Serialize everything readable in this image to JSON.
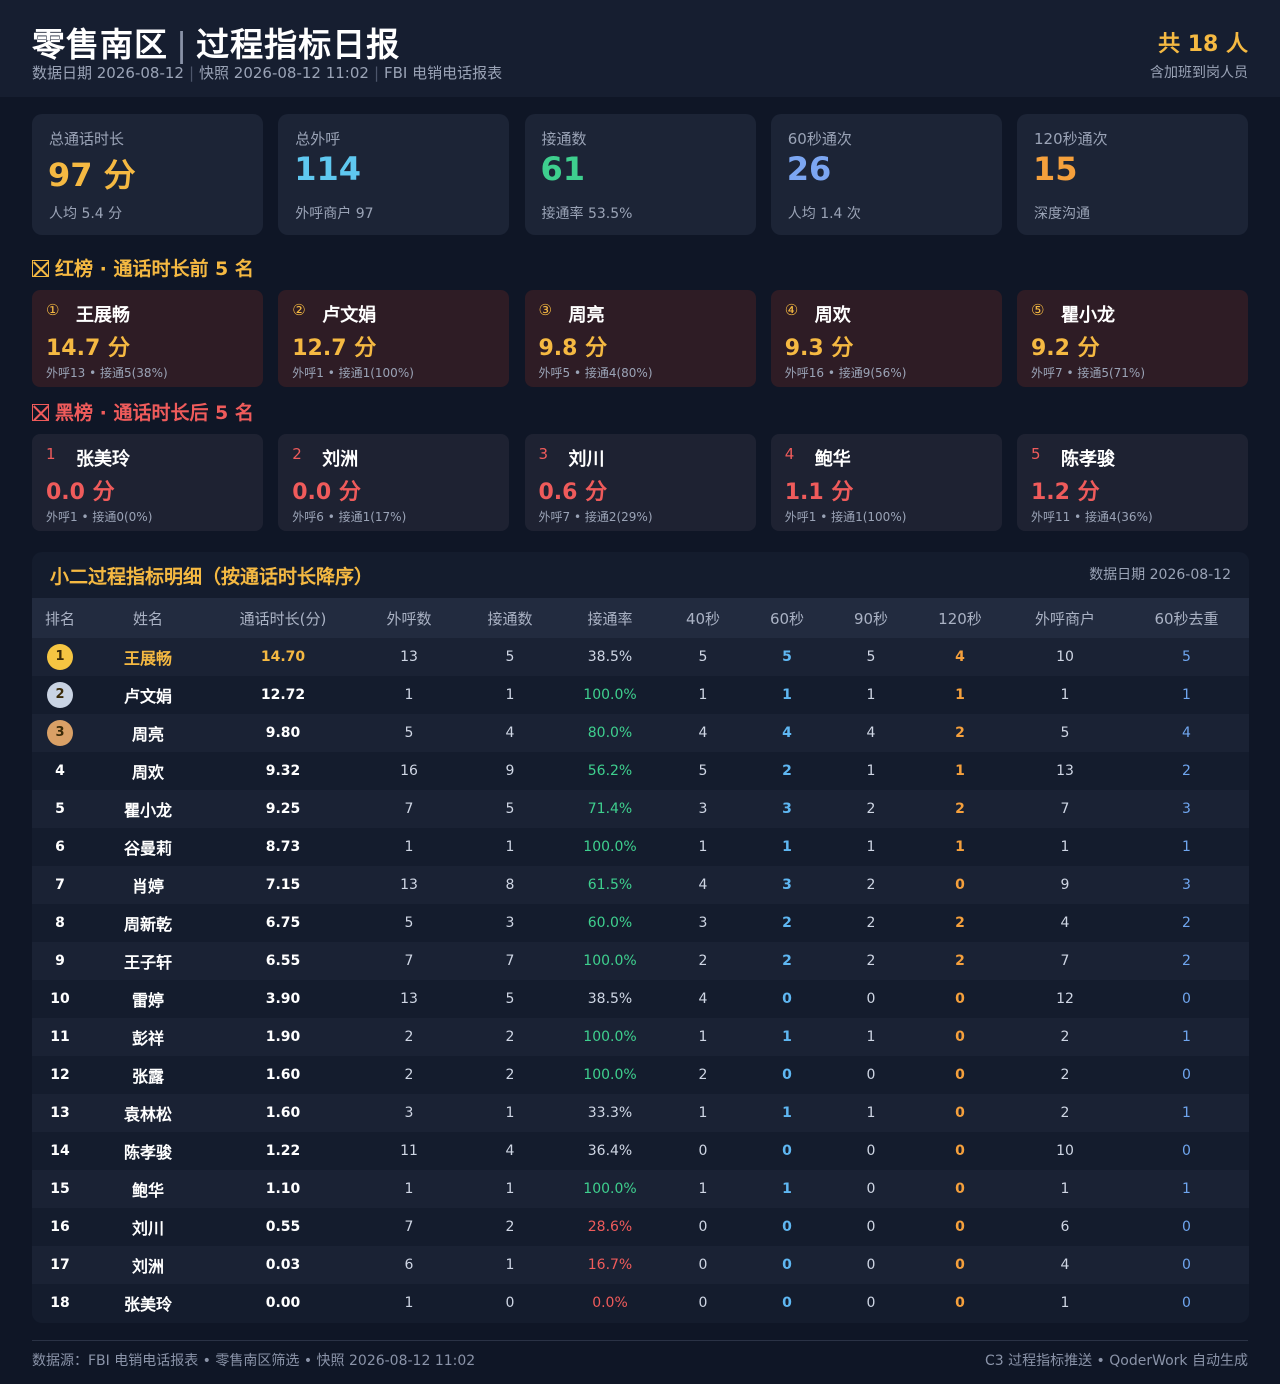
{
  "header": {
    "title_left": "零售南区",
    "title_sep": "|",
    "title_right": "过程指标日报",
    "sub_date": "数据日期 2026-08-12",
    "sub_snapshot": "快照 2026-08-12 11:02",
    "sub_source": "FBI 电销电话报表",
    "count": "共 18 人",
    "count_note": "含加班到岗人员"
  },
  "kpis": [
    {
      "label": "总通话时长",
      "value": "97 分",
      "sub": "人均 5.4 分",
      "color": "#f5b942"
    },
    {
      "label": "总外呼",
      "value": "114",
      "sub": "外呼商户 97",
      "color": "#5fc8f0"
    },
    {
      "label": "接通数",
      "value": "61",
      "sub": "接通率 53.5%",
      "color": "#3ecf8e"
    },
    {
      "label": "60秒通次",
      "value": "26",
      "sub": "人均 1.4 次",
      "color": "#7ca6f2"
    },
    {
      "label": "120秒通次",
      "value": "15",
      "sub": "深度沟通",
      "color": "#f5a03c"
    }
  ],
  "red_board": {
    "title": "红榜 · 通话时长前 5 名",
    "color": "#f5b942",
    "items": [
      {
        "rank": "①",
        "name": "王展畅",
        "value": "14.7 分",
        "meta": "外呼13 • 接通5(38%)"
      },
      {
        "rank": "②",
        "name": "卢文娟",
        "value": "12.7 分",
        "meta": "外呼1 • 接通1(100%)"
      },
      {
        "rank": "③",
        "name": "周亮",
        "value": "9.8 分",
        "meta": "外呼5 • 接通4(80%)"
      },
      {
        "rank": "④",
        "name": "周欢",
        "value": "9.3 分",
        "meta": "外呼16 • 接通9(56%)"
      },
      {
        "rank": "⑤",
        "name": "瞿小龙",
        "value": "9.2 分",
        "meta": "外呼7 • 接通5(71%)"
      }
    ]
  },
  "black_board": {
    "title": "黑榜 · 通话时长后 5 名",
    "color": "#ef5b5b",
    "items": [
      {
        "rank": "1",
        "name": "张美玲",
        "value": "0.0 分",
        "meta": "外呼1 • 接通0(0%)"
      },
      {
        "rank": "2",
        "name": "刘洲",
        "value": "0.0 分",
        "meta": "外呼6 • 接通1(17%)"
      },
      {
        "rank": "3",
        "name": "刘川",
        "value": "0.6 分",
        "meta": "外呼7 • 接通2(29%)"
      },
      {
        "rank": "4",
        "name": "鲍华",
        "value": "1.1 分",
        "meta": "外呼1 • 接通1(100%)"
      },
      {
        "rank": "5",
        "name": "陈孝骏",
        "value": "1.2 分",
        "meta": "外呼11 • 接通4(36%)"
      }
    ]
  },
  "table": {
    "title": "小二过程指标明细（按通话时长降序）",
    "date": "数据日期 2026-08-12",
    "columns": [
      "排名",
      "姓名",
      "通话时长(分)",
      "外呼数",
      "接通数",
      "接通率",
      "40秒",
      "60秒",
      "90秒",
      "120秒",
      "外呼商户",
      "60秒去重"
    ],
    "rows": [
      [
        "1",
        "王展畅",
        "14.70",
        "13",
        "5",
        "38.5%",
        "5",
        "5",
        "5",
        "4",
        "10",
        "5"
      ],
      [
        "2",
        "卢文娟",
        "12.72",
        "1",
        "1",
        "100.0%",
        "1",
        "1",
        "1",
        "1",
        "1",
        "1"
      ],
      [
        "3",
        "周亮",
        "9.80",
        "5",
        "4",
        "80.0%",
        "4",
        "4",
        "4",
        "2",
        "5",
        "4"
      ],
      [
        "4",
        "周欢",
        "9.32",
        "16",
        "9",
        "56.2%",
        "5",
        "2",
        "1",
        "1",
        "13",
        "2"
      ],
      [
        "5",
        "瞿小龙",
        "9.25",
        "7",
        "5",
        "71.4%",
        "3",
        "3",
        "2",
        "2",
        "7",
        "3"
      ],
      [
        "6",
        "谷曼莉",
        "8.73",
        "1",
        "1",
        "100.0%",
        "1",
        "1",
        "1",
        "1",
        "1",
        "1"
      ],
      [
        "7",
        "肖婷",
        "7.15",
        "13",
        "8",
        "61.5%",
        "4",
        "3",
        "2",
        "0",
        "9",
        "3"
      ],
      [
        "8",
        "周新乾",
        "6.75",
        "5",
        "3",
        "60.0%",
        "3",
        "2",
        "2",
        "2",
        "4",
        "2"
      ],
      [
        "9",
        "王子轩",
        "6.55",
        "7",
        "7",
        "100.0%",
        "2",
        "2",
        "2",
        "2",
        "7",
        "2"
      ],
      [
        "10",
        "雷婷",
        "3.90",
        "13",
        "5",
        "38.5%",
        "4",
        "0",
        "0",
        "0",
        "12",
        "0"
      ],
      [
        "11",
        "彭祥",
        "1.90",
        "2",
        "2",
        "100.0%",
        "1",
        "1",
        "1",
        "0",
        "2",
        "1"
      ],
      [
        "12",
        "张露",
        "1.60",
        "2",
        "2",
        "100.0%",
        "2",
        "0",
        "0",
        "0",
        "2",
        "0"
      ],
      [
        "13",
        "袁林松",
        "1.60",
        "3",
        "1",
        "33.3%",
        "1",
        "1",
        "1",
        "0",
        "2",
        "1"
      ],
      [
        "14",
        "陈孝骏",
        "1.22",
        "11",
        "4",
        "36.4%",
        "0",
        "0",
        "0",
        "0",
        "10",
        "0"
      ],
      [
        "15",
        "鲍华",
        "1.10",
        "1",
        "1",
        "100.0%",
        "1",
        "1",
        "0",
        "0",
        "1",
        "1"
      ],
      [
        "16",
        "刘川",
        "0.55",
        "7",
        "2",
        "28.6%",
        "0",
        "0",
        "0",
        "0",
        "6",
        "0"
      ],
      [
        "17",
        "刘洲",
        "0.03",
        "6",
        "1",
        "16.7%",
        "0",
        "0",
        "0",
        "0",
        "4",
        "0"
      ],
      [
        "18",
        "张美玲",
        "0.00",
        "1",
        "0",
        "0.0%",
        "0",
        "0",
        "0",
        "0",
        "1",
        "0"
      ]
    ],
    "rate_colors": {
      "high": "#3ecf8e",
      "neutral": "#cfd6e4",
      "low": "#ef5b5b"
    },
    "medal_colors": [
      "#f5c542",
      "#c9d3e3",
      "#d9a066"
    ]
  },
  "footer": {
    "left": "数据源：FBI 电销电话报表 • 零售南区筛选 • 快照 2026-08-12 11:02",
    "right": "C3 过程指标推送 • QoderWork 自动生成"
  }
}
